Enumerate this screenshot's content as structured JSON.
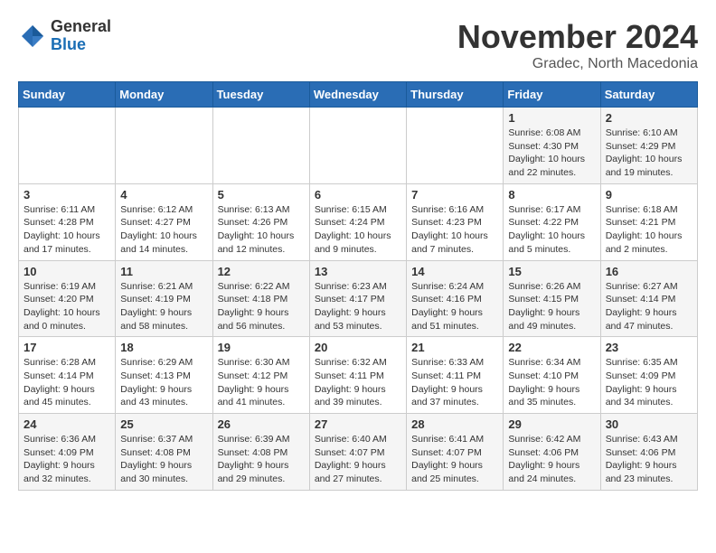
{
  "logo": {
    "general": "General",
    "blue": "Blue"
  },
  "title": "November 2024",
  "subtitle": "Gradec, North Macedonia",
  "days_of_week": [
    "Sunday",
    "Monday",
    "Tuesday",
    "Wednesday",
    "Thursday",
    "Friday",
    "Saturday"
  ],
  "weeks": [
    [
      {
        "day": "",
        "content": ""
      },
      {
        "day": "",
        "content": ""
      },
      {
        "day": "",
        "content": ""
      },
      {
        "day": "",
        "content": ""
      },
      {
        "day": "",
        "content": ""
      },
      {
        "day": "1",
        "content": "Sunrise: 6:08 AM\nSunset: 4:30 PM\nDaylight: 10 hours and 22 minutes."
      },
      {
        "day": "2",
        "content": "Sunrise: 6:10 AM\nSunset: 4:29 PM\nDaylight: 10 hours and 19 minutes."
      }
    ],
    [
      {
        "day": "3",
        "content": "Sunrise: 6:11 AM\nSunset: 4:28 PM\nDaylight: 10 hours and 17 minutes."
      },
      {
        "day": "4",
        "content": "Sunrise: 6:12 AM\nSunset: 4:27 PM\nDaylight: 10 hours and 14 minutes."
      },
      {
        "day": "5",
        "content": "Sunrise: 6:13 AM\nSunset: 4:26 PM\nDaylight: 10 hours and 12 minutes."
      },
      {
        "day": "6",
        "content": "Sunrise: 6:15 AM\nSunset: 4:24 PM\nDaylight: 10 hours and 9 minutes."
      },
      {
        "day": "7",
        "content": "Sunrise: 6:16 AM\nSunset: 4:23 PM\nDaylight: 10 hours and 7 minutes."
      },
      {
        "day": "8",
        "content": "Sunrise: 6:17 AM\nSunset: 4:22 PM\nDaylight: 10 hours and 5 minutes."
      },
      {
        "day": "9",
        "content": "Sunrise: 6:18 AM\nSunset: 4:21 PM\nDaylight: 10 hours and 2 minutes."
      }
    ],
    [
      {
        "day": "10",
        "content": "Sunrise: 6:19 AM\nSunset: 4:20 PM\nDaylight: 10 hours and 0 minutes."
      },
      {
        "day": "11",
        "content": "Sunrise: 6:21 AM\nSunset: 4:19 PM\nDaylight: 9 hours and 58 minutes."
      },
      {
        "day": "12",
        "content": "Sunrise: 6:22 AM\nSunset: 4:18 PM\nDaylight: 9 hours and 56 minutes."
      },
      {
        "day": "13",
        "content": "Sunrise: 6:23 AM\nSunset: 4:17 PM\nDaylight: 9 hours and 53 minutes."
      },
      {
        "day": "14",
        "content": "Sunrise: 6:24 AM\nSunset: 4:16 PM\nDaylight: 9 hours and 51 minutes."
      },
      {
        "day": "15",
        "content": "Sunrise: 6:26 AM\nSunset: 4:15 PM\nDaylight: 9 hours and 49 minutes."
      },
      {
        "day": "16",
        "content": "Sunrise: 6:27 AM\nSunset: 4:14 PM\nDaylight: 9 hours and 47 minutes."
      }
    ],
    [
      {
        "day": "17",
        "content": "Sunrise: 6:28 AM\nSunset: 4:14 PM\nDaylight: 9 hours and 45 minutes."
      },
      {
        "day": "18",
        "content": "Sunrise: 6:29 AM\nSunset: 4:13 PM\nDaylight: 9 hours and 43 minutes."
      },
      {
        "day": "19",
        "content": "Sunrise: 6:30 AM\nSunset: 4:12 PM\nDaylight: 9 hours and 41 minutes."
      },
      {
        "day": "20",
        "content": "Sunrise: 6:32 AM\nSunset: 4:11 PM\nDaylight: 9 hours and 39 minutes."
      },
      {
        "day": "21",
        "content": "Sunrise: 6:33 AM\nSunset: 4:11 PM\nDaylight: 9 hours and 37 minutes."
      },
      {
        "day": "22",
        "content": "Sunrise: 6:34 AM\nSunset: 4:10 PM\nDaylight: 9 hours and 35 minutes."
      },
      {
        "day": "23",
        "content": "Sunrise: 6:35 AM\nSunset: 4:09 PM\nDaylight: 9 hours and 34 minutes."
      }
    ],
    [
      {
        "day": "24",
        "content": "Sunrise: 6:36 AM\nSunset: 4:09 PM\nDaylight: 9 hours and 32 minutes."
      },
      {
        "day": "25",
        "content": "Sunrise: 6:37 AM\nSunset: 4:08 PM\nDaylight: 9 hours and 30 minutes."
      },
      {
        "day": "26",
        "content": "Sunrise: 6:39 AM\nSunset: 4:08 PM\nDaylight: 9 hours and 29 minutes."
      },
      {
        "day": "27",
        "content": "Sunrise: 6:40 AM\nSunset: 4:07 PM\nDaylight: 9 hours and 27 minutes."
      },
      {
        "day": "28",
        "content": "Sunrise: 6:41 AM\nSunset: 4:07 PM\nDaylight: 9 hours and 25 minutes."
      },
      {
        "day": "29",
        "content": "Sunrise: 6:42 AM\nSunset: 4:06 PM\nDaylight: 9 hours and 24 minutes."
      },
      {
        "day": "30",
        "content": "Sunrise: 6:43 AM\nSunset: 4:06 PM\nDaylight: 9 hours and 23 minutes."
      }
    ]
  ]
}
